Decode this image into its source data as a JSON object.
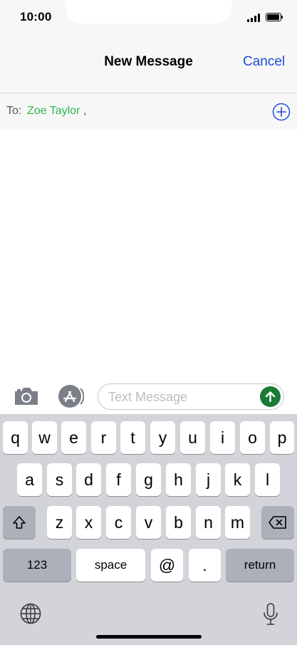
{
  "status_bar": {
    "time": "10:00"
  },
  "header": {
    "title": "New Message",
    "cancel_label": "Cancel"
  },
  "recipient": {
    "to_label": "To:",
    "name": "Zoe Taylor",
    "separator": ","
  },
  "compose": {
    "placeholder": "Text Message"
  },
  "icons": {
    "add_recipient": "plus-circle-icon",
    "camera": "camera-icon",
    "app_store": "app-store-icon",
    "send": "arrow-up-icon",
    "shift": "shift-icon",
    "delete": "backspace-icon",
    "globe": "globe-icon",
    "mic": "microphone-icon"
  },
  "colors": {
    "accent": "#1c4fd6",
    "recipient": "#2db84d",
    "send_button": "#1b7a35"
  },
  "keyboard": {
    "row1": [
      "q",
      "w",
      "e",
      "r",
      "t",
      "y",
      "u",
      "i",
      "o",
      "p"
    ],
    "row2": [
      "a",
      "s",
      "d",
      "f",
      "g",
      "h",
      "j",
      "k",
      "l"
    ],
    "row3": [
      "z",
      "x",
      "c",
      "v",
      "b",
      "n",
      "m"
    ],
    "numbers_label": "123",
    "space_label": "space",
    "at_label": "@",
    "period_label": ".",
    "return_label": "return"
  }
}
